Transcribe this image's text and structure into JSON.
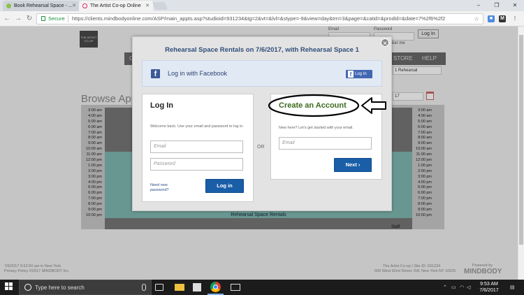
{
  "browser": {
    "tabs": [
      {
        "title": "Book Rehearsal Space - ...",
        "favicon_color": "#8bc34a"
      },
      {
        "title": "The Artist Co-op Online",
        "favicon_color": "#d81b60"
      }
    ],
    "secure_label": "Secure",
    "url": "https://clients.mindbodyonline.com/ASP/main_appts.asp?studioid=931234&tg=2&vt=&lvl=&stype=-9&view=day&trn=3&page=&catid=&prodid=&date=7%2f6%2f2"
  },
  "background": {
    "logo_text": "THE ARTIST CO-OP",
    "email_label": "Email",
    "password_label": "Password",
    "login_button": "Log In",
    "remember_me": "Remember me",
    "nav_items": [
      "C",
      "STORE",
      "HELP"
    ],
    "resource_select": "1 Rehearsal",
    "date_suffix": "17",
    "browse_title": "Browse Appo",
    "times": [
      "3:00 am",
      "4:00 am",
      "5:00 am",
      "6:00 am",
      "7:00 am",
      "8:00 am",
      "9:00 am",
      "10:00 am",
      "11:00 am",
      "12:00 pm",
      "1:00 pm",
      "2:00 pm",
      "3:00 pm",
      "4:00 pm",
      "5:00 pm",
      "6:00 pm",
      "7:00 pm",
      "8:00 pm",
      "9:00 pm",
      "10:00 pm"
    ],
    "booking_label": "Rehearsal Space Rentals",
    "staff_label": "Staff",
    "footer_left_1": "7/6/2017 9:52:50 am in New York",
    "footer_left_2": "Privacy Policy  ©2017 MINDBODY Inc.",
    "footer_right_1": "The Artist Co-op  |  Site ID: 931234",
    "footer_right_2": "600 West 92nd Street, 6W, New York NY 10025",
    "powered_by": "Powered by",
    "mindbody": "MINDBODY"
  },
  "modal": {
    "title": "Rehearsal Space Rentals  on 7/6/2017, with Rehearsal Space 1",
    "facebook_text": "Log in with Facebook",
    "facebook_button": "Log In",
    "login": {
      "heading": "Log In",
      "description": "Welcome back. Use your email and password to log in.",
      "email_placeholder": "Email",
      "password_placeholder": "Password",
      "need_new": "Need new password?",
      "button": "Log in"
    },
    "or_label": "OR",
    "create": {
      "heading": "Create an Account",
      "description": "New here? Let's get started with your email.",
      "email_placeholder": "Email",
      "button": "Next ›"
    }
  },
  "annotation": {
    "color": "#000000",
    "shape": "ellipse-and-arrow"
  },
  "taskbar": {
    "search_placeholder": "Type here to search",
    "time": "9:53 AM",
    "date": "7/6/2017"
  }
}
